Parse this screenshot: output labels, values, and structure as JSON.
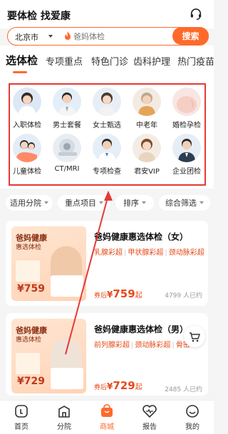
{
  "header": {
    "slogan": "要体检 找爱康"
  },
  "search": {
    "city": "北京市",
    "placeholder": "爸妈体检",
    "button": "搜索"
  },
  "tabs": [
    "选体检",
    "专项重点",
    "特色门诊",
    "齿科护理",
    "热门疫苗"
  ],
  "categories": [
    {
      "label": "入职体检",
      "icon": "avatar-woman-icon",
      "color": "#dde8f5"
    },
    {
      "label": "男士套餐",
      "icon": "avatar-man-icon",
      "color": "#e3eef8"
    },
    {
      "label": "女士甄选",
      "icon": "avatar-woman-icon",
      "color": "#e8eef6"
    },
    {
      "label": "中老年",
      "icon": "avatar-elder-icon",
      "color": "#f3ebe2"
    },
    {
      "label": "婚检孕检",
      "icon": "avatar-pregnant-icon",
      "color": "#f7e6e3"
    },
    {
      "label": "儿童体检",
      "icon": "avatar-child-icon",
      "color": "#e4ecf5"
    },
    {
      "label": "CT/MRI",
      "icon": "mri-machine-icon",
      "color": "#e8edf2"
    },
    {
      "label": "专项检查",
      "icon": "avatar-doctor-icon",
      "color": "#e6eef7"
    },
    {
      "label": "君安VIP",
      "icon": "avatar-woman-icon",
      "color": "#f4ece4"
    },
    {
      "label": "企业团检",
      "icon": "avatar-man-icon",
      "color": "#e6edf4"
    }
  ],
  "filters": [
    "适用分院",
    "重点项目",
    "排序",
    "综合筛选"
  ],
  "products": [
    {
      "name": "爸妈健康惠选体检（女）",
      "items": [
        "乳腺彩超",
        "甲状腺彩超",
        "颈动脉彩超"
      ],
      "price_prefix": "券后",
      "price_symbol": "¥",
      "price": "759",
      "price_suffix": "起",
      "sold": "4799 人已约",
      "thumb_title": "爸妈健康",
      "thumb_subtitle": "惠选体检",
      "thumb_price": "¥759"
    },
    {
      "name": "爸妈健康惠选体检（男）",
      "items": [
        "前列腺彩超",
        "颈动脉彩超",
        "骨密"
      ],
      "price_prefix": "券后",
      "price_symbol": "¥",
      "price": "729",
      "price_suffix": "起",
      "sold": "2485 人已约",
      "thumb_title": "爸妈健康",
      "thumb_subtitle": "惠选体检",
      "thumb_price": "¥729"
    }
  ],
  "bottom_nav": [
    {
      "label": "首页",
      "icon": "home-icon",
      "active": false
    },
    {
      "label": "分院",
      "icon": "building-icon",
      "active": false
    },
    {
      "label": "商城",
      "icon": "mall-bag-icon",
      "active": true
    },
    {
      "label": "报告",
      "icon": "heart-report-icon",
      "active": false
    },
    {
      "label": "我的",
      "icon": "smile-face-icon",
      "active": false
    }
  ],
  "colors": {
    "accent": "#ff6a2a",
    "price": "#e64a19",
    "annotation": "#e53935"
  }
}
